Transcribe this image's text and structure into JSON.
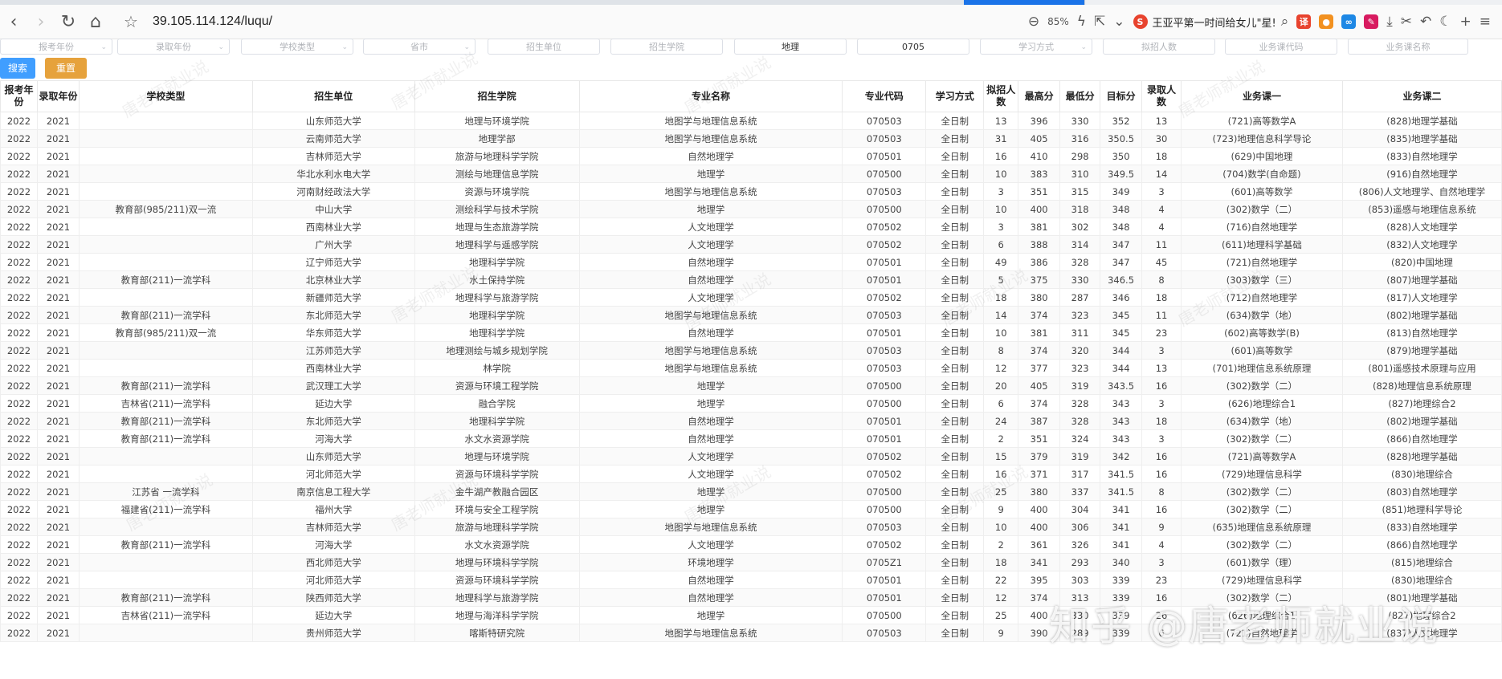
{
  "browser": {
    "url": "39.105.114.124/luqu/",
    "zoom": "85%",
    "search_text": "王亚平第一时间给女儿\"星!",
    "icons": [
      "back-icon",
      "forward-icon",
      "reload-icon",
      "home-icon",
      "star-icon",
      "zoom-icon",
      "lightning-icon",
      "share-icon",
      "chevron-down-icon",
      "search-icon",
      "translate-icon",
      "game-icon",
      "infinity-icon",
      "ext-icon",
      "download-icon",
      "scissors-icon",
      "undo-icon",
      "moon-icon",
      "plus-icon",
      "menu-icon"
    ]
  },
  "filters": [
    {
      "label": "报考年份",
      "filled": false,
      "has_dropdown": true
    },
    {
      "label": "录取年份",
      "filled": false,
      "has_dropdown": true
    },
    {
      "label": "学校类型",
      "filled": false,
      "has_dropdown": true
    },
    {
      "label": "省市",
      "filled": false,
      "has_dropdown": true
    },
    {
      "label": "招生单位",
      "filled": false,
      "has_dropdown": false
    },
    {
      "label": "招生学院",
      "filled": false,
      "has_dropdown": false
    },
    {
      "label": "地理",
      "filled": true,
      "has_dropdown": false
    },
    {
      "label": "0705",
      "filled": true,
      "has_dropdown": false
    },
    {
      "label": "学习方式",
      "filled": false,
      "has_dropdown": true
    },
    {
      "label": "拟招人数",
      "filled": false,
      "has_dropdown": false
    },
    {
      "label": "业务课代码",
      "filled": false,
      "has_dropdown": false
    },
    {
      "label": "业务课名称",
      "filled": false,
      "has_dropdown": false
    }
  ],
  "buttons": {
    "search": "搜索",
    "reset": "重置"
  },
  "table": {
    "headers": [
      "报考年份",
      "录取年份",
      "学校类型",
      "招生单位",
      "招生学院",
      "专业名称",
      "专业代码",
      "学习方式",
      "拟招人数",
      "最高分",
      "最低分",
      "目标分",
      "录取人数",
      "业务课一",
      "业务课二"
    ],
    "rows": [
      [
        "2022",
        "2021",
        "",
        "山东师范大学",
        "地理与环境学院",
        "地图学与地理信息系统",
        "070503",
        "全日制",
        "13",
        "396",
        "330",
        "352",
        "13",
        "(721)高等数学A",
        "(828)地理学基础"
      ],
      [
        "2022",
        "2021",
        "",
        "云南师范大学",
        "地理学部",
        "地图学与地理信息系统",
        "070503",
        "全日制",
        "31",
        "405",
        "316",
        "350.5",
        "30",
        "(723)地理信息科学导论",
        "(835)地理学基础"
      ],
      [
        "2022",
        "2021",
        "",
        "吉林师范大学",
        "旅游与地理科学学院",
        "自然地理学",
        "070501",
        "全日制",
        "16",
        "410",
        "298",
        "350",
        "18",
        "(629)中国地理",
        "(833)自然地理学"
      ],
      [
        "2022",
        "2021",
        "",
        "华北水利水电大学",
        "测绘与地理信息学院",
        "地理学",
        "070500",
        "全日制",
        "10",
        "383",
        "310",
        "349.5",
        "14",
        "(704)数学(自命题)",
        "(916)自然地理学"
      ],
      [
        "2022",
        "2021",
        "",
        "河南财经政法大学",
        "资源与环境学院",
        "地图学与地理信息系统",
        "070503",
        "全日制",
        "3",
        "351",
        "315",
        "349",
        "3",
        "(601)高等数学",
        "(806)人文地理学、自然地理学"
      ],
      [
        "2022",
        "2021",
        "教育部(985/211)双一流",
        "中山大学",
        "测绘科学与技术学院",
        "地理学",
        "070500",
        "全日制",
        "10",
        "400",
        "318",
        "348",
        "4",
        "(302)数学（二）",
        "(853)遥感与地理信息系统"
      ],
      [
        "2022",
        "2021",
        "",
        "西南林业大学",
        "地理与生态旅游学院",
        "人文地理学",
        "070502",
        "全日制",
        "3",
        "381",
        "302",
        "348",
        "4",
        "(716)自然地理学",
        "(828)人文地理学"
      ],
      [
        "2022",
        "2021",
        "",
        "广州大学",
        "地理科学与遥感学院",
        "人文地理学",
        "070502",
        "全日制",
        "6",
        "388",
        "314",
        "347",
        "11",
        "(611)地理科学基础",
        "(832)人文地理学"
      ],
      [
        "2022",
        "2021",
        "",
        "辽宁师范大学",
        "地理科学学院",
        "自然地理学",
        "070501",
        "全日制",
        "49",
        "386",
        "328",
        "347",
        "45",
        "(721)自然地理学",
        "(820)中国地理"
      ],
      [
        "2022",
        "2021",
        "教育部(211)一流学科",
        "北京林业大学",
        "水土保持学院",
        "自然地理学",
        "070501",
        "全日制",
        "5",
        "375",
        "330",
        "346.5",
        "8",
        "(303)数学（三）",
        "(807)地理学基础"
      ],
      [
        "2022",
        "2021",
        "",
        "新疆师范大学",
        "地理科学与旅游学院",
        "人文地理学",
        "070502",
        "全日制",
        "18",
        "380",
        "287",
        "346",
        "18",
        "(712)自然地理学",
        "(817)人文地理学"
      ],
      [
        "2022",
        "2021",
        "教育部(211)一流学科",
        "东北师范大学",
        "地理科学学院",
        "地图学与地理信息系统",
        "070503",
        "全日制",
        "14",
        "374",
        "323",
        "345",
        "11",
        "(634)数学（地）",
        "(802)地理学基础"
      ],
      [
        "2022",
        "2021",
        "教育部(985/211)双一流",
        "华东师范大学",
        "地理科学学院",
        "自然地理学",
        "070501",
        "全日制",
        "10",
        "381",
        "311",
        "345",
        "23",
        "(602)高等数学(B)",
        "(813)自然地理学"
      ],
      [
        "2022",
        "2021",
        "",
        "江苏师范大学",
        "地理测绘与城乡规划学院",
        "地图学与地理信息系统",
        "070503",
        "全日制",
        "8",
        "374",
        "320",
        "344",
        "3",
        "(601)高等数学",
        "(879)地理学基础"
      ],
      [
        "2022",
        "2021",
        "",
        "西南林业大学",
        "林学院",
        "地图学与地理信息系统",
        "070503",
        "全日制",
        "12",
        "377",
        "323",
        "344",
        "13",
        "(701)地理信息系统原理",
        "(801)遥感技术原理与应用"
      ],
      [
        "2022",
        "2021",
        "教育部(211)一流学科",
        "武汉理工大学",
        "资源与环境工程学院",
        "地理学",
        "070500",
        "全日制",
        "20",
        "405",
        "319",
        "343.5",
        "16",
        "(302)数学（二）",
        "(828)地理信息系统原理"
      ],
      [
        "2022",
        "2021",
        "吉林省(211)一流学科",
        "延边大学",
        "融合学院",
        "地理学",
        "070500",
        "全日制",
        "6",
        "374",
        "328",
        "343",
        "3",
        "(626)地理综合1",
        "(827)地理综合2"
      ],
      [
        "2022",
        "2021",
        "教育部(211)一流学科",
        "东北师范大学",
        "地理科学学院",
        "自然地理学",
        "070501",
        "全日制",
        "24",
        "387",
        "328",
        "343",
        "18",
        "(634)数学（地）",
        "(802)地理学基础"
      ],
      [
        "2022",
        "2021",
        "教育部(211)一流学科",
        "河海大学",
        "水文水资源学院",
        "自然地理学",
        "070501",
        "全日制",
        "2",
        "351",
        "324",
        "343",
        "3",
        "(302)数学（二）",
        "(866)自然地理学"
      ],
      [
        "2022",
        "2021",
        "",
        "山东师范大学",
        "地理与环境学院",
        "人文地理学",
        "070502",
        "全日制",
        "15",
        "379",
        "319",
        "342",
        "16",
        "(721)高等数学A",
        "(828)地理学基础"
      ],
      [
        "2022",
        "2021",
        "",
        "河北师范大学",
        "资源与环境科学学院",
        "人文地理学",
        "070502",
        "全日制",
        "16",
        "371",
        "317",
        "341.5",
        "16",
        "(729)地理信息科学",
        "(830)地理综合"
      ],
      [
        "2022",
        "2021",
        "江苏省 一流学科",
        "南京信息工程大学",
        "金牛湖产教融合园区",
        "地理学",
        "070500",
        "全日制",
        "25",
        "380",
        "337",
        "341.5",
        "8",
        "(302)数学（二）",
        "(803)自然地理学"
      ],
      [
        "2022",
        "2021",
        "福建省(211)一流学科",
        "福州大学",
        "环境与安全工程学院",
        "地理学",
        "070500",
        "全日制",
        "9",
        "400",
        "304",
        "341",
        "16",
        "(302)数学（二）",
        "(851)地理科学导论"
      ],
      [
        "2022",
        "2021",
        "",
        "吉林师范大学",
        "旅游与地理科学学院",
        "地图学与地理信息系统",
        "070503",
        "全日制",
        "10",
        "400",
        "306",
        "341",
        "9",
        "(635)地理信息系统原理",
        "(833)自然地理学"
      ],
      [
        "2022",
        "2021",
        "教育部(211)一流学科",
        "河海大学",
        "水文水资源学院",
        "人文地理学",
        "070502",
        "全日制",
        "2",
        "361",
        "326",
        "341",
        "4",
        "(302)数学（二）",
        "(866)自然地理学"
      ],
      [
        "2022",
        "2021",
        "",
        "西北师范大学",
        "地理与环境科学学院",
        "环境地理学",
        "0705Z1",
        "全日制",
        "18",
        "341",
        "293",
        "340",
        "3",
        "(601)数学（理）",
        "(815)地理综合"
      ],
      [
        "2022",
        "2021",
        "",
        "河北师范大学",
        "资源与环境科学学院",
        "自然地理学",
        "070501",
        "全日制",
        "22",
        "395",
        "303",
        "339",
        "23",
        "(729)地理信息科学",
        "(830)地理综合"
      ],
      [
        "2022",
        "2021",
        "教育部(211)一流学科",
        "陕西师范大学",
        "地理科学与旅游学院",
        "自然地理学",
        "070501",
        "全日制",
        "12",
        "374",
        "313",
        "339",
        "16",
        "(302)数学（二）",
        "(801)地理学基础"
      ],
      [
        "2022",
        "2021",
        "吉林省(211)一流学科",
        "延边大学",
        "地理与海洋科学学院",
        "地理学",
        "070500",
        "全日制",
        "25",
        "400",
        "330",
        "339",
        "26",
        "(626)地理综合1",
        "(827)地理综合2"
      ],
      [
        "2022",
        "2021",
        "",
        "贵州师范大学",
        "喀斯特研究院",
        "地图学与地理信息系统",
        "070503",
        "全日制",
        "9",
        "390",
        "289",
        "339",
        "6",
        "(721)自然地理学",
        "(837)人文地理学"
      ]
    ]
  },
  "watermarks": {
    "site": "唐老师就业说",
    "zhihu": "知乎 @唐老师就业说"
  }
}
